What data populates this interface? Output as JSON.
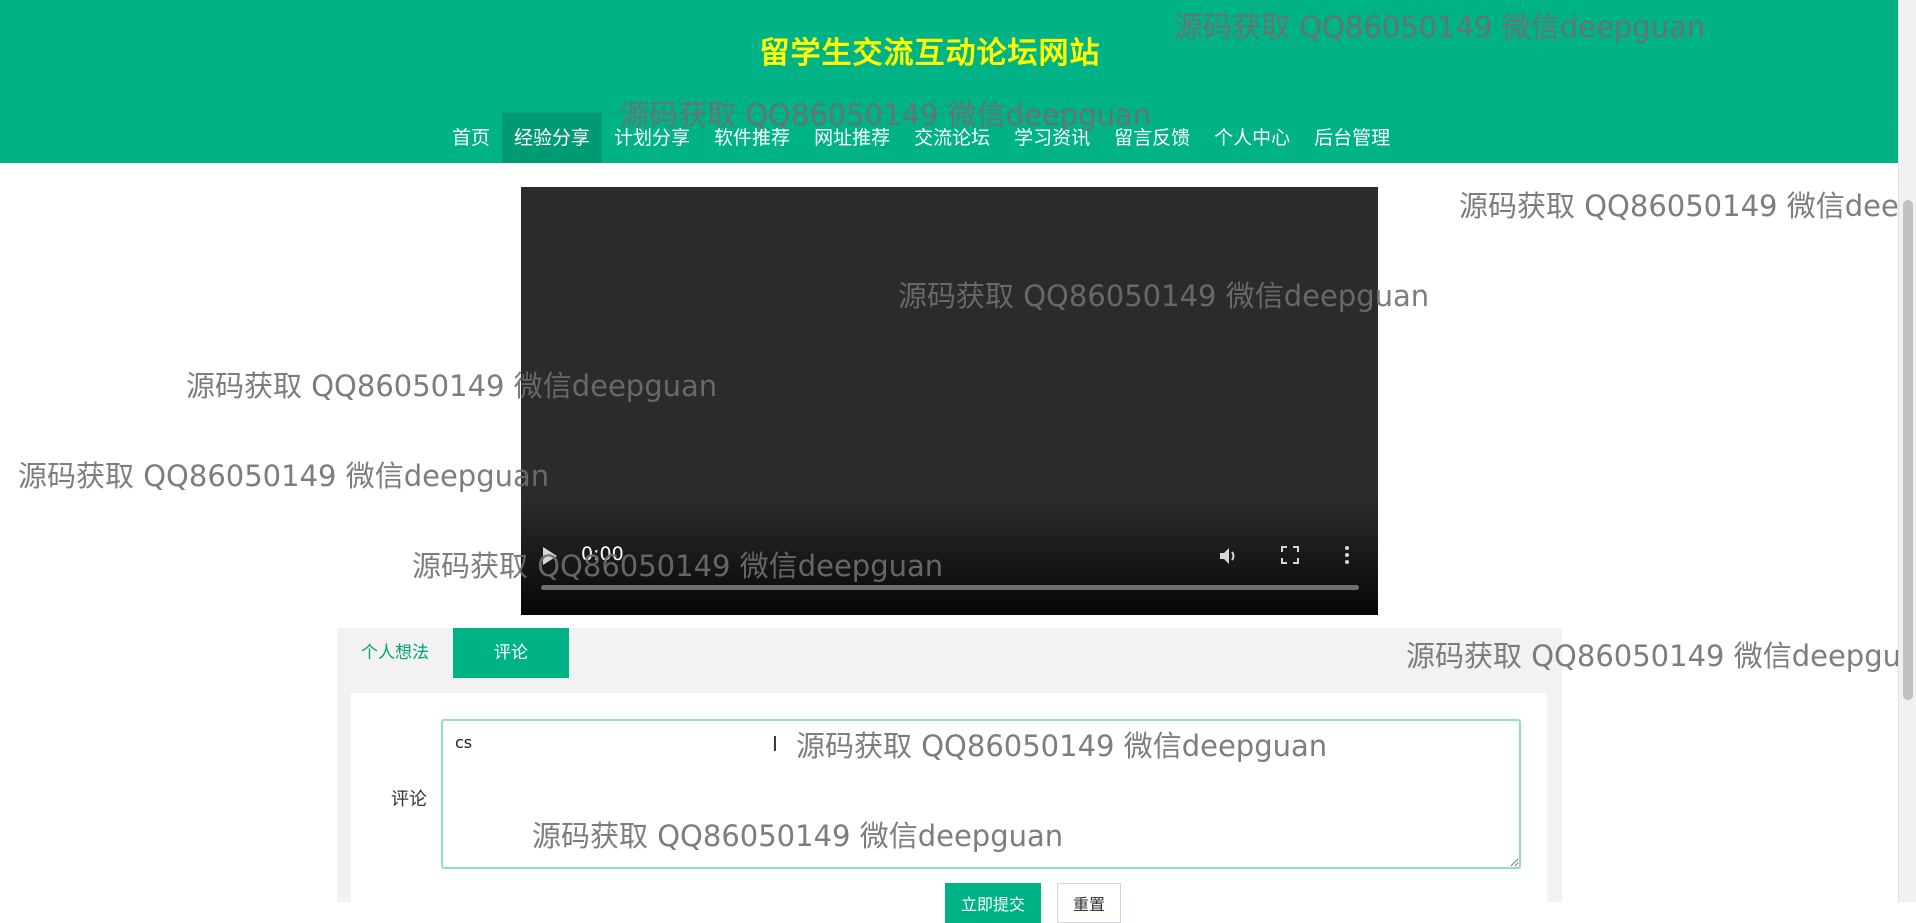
{
  "header": {
    "title": "留学生交流互动论坛网站"
  },
  "nav": [
    {
      "label": "首页"
    },
    {
      "label": "经验分享"
    },
    {
      "label": "计划分享"
    },
    {
      "label": "软件推荐"
    },
    {
      "label": "网址推荐"
    },
    {
      "label": "交流论坛"
    },
    {
      "label": "学习资讯"
    },
    {
      "label": "留言反馈"
    },
    {
      "label": "个人中心"
    },
    {
      "label": "后台管理"
    }
  ],
  "nav_active": "经验分享",
  "video": {
    "time": "0:00",
    "icons": [
      "play-icon",
      "volume-icon",
      "fullscreen-icon",
      "more-options-icon"
    ]
  },
  "tabs": [
    {
      "label": "个人想法"
    },
    {
      "label": "评论"
    }
  ],
  "tab_active": "评论",
  "comment_form": {
    "label": "评论",
    "value": "cs",
    "submit_label": "立即提交",
    "reset_label": "重置"
  },
  "watermark": "源码获取 QQ86050149 微信deepguan",
  "colors": {
    "primary": "#00b386",
    "title": "#ffff00",
    "active_nav": "#009a73"
  }
}
